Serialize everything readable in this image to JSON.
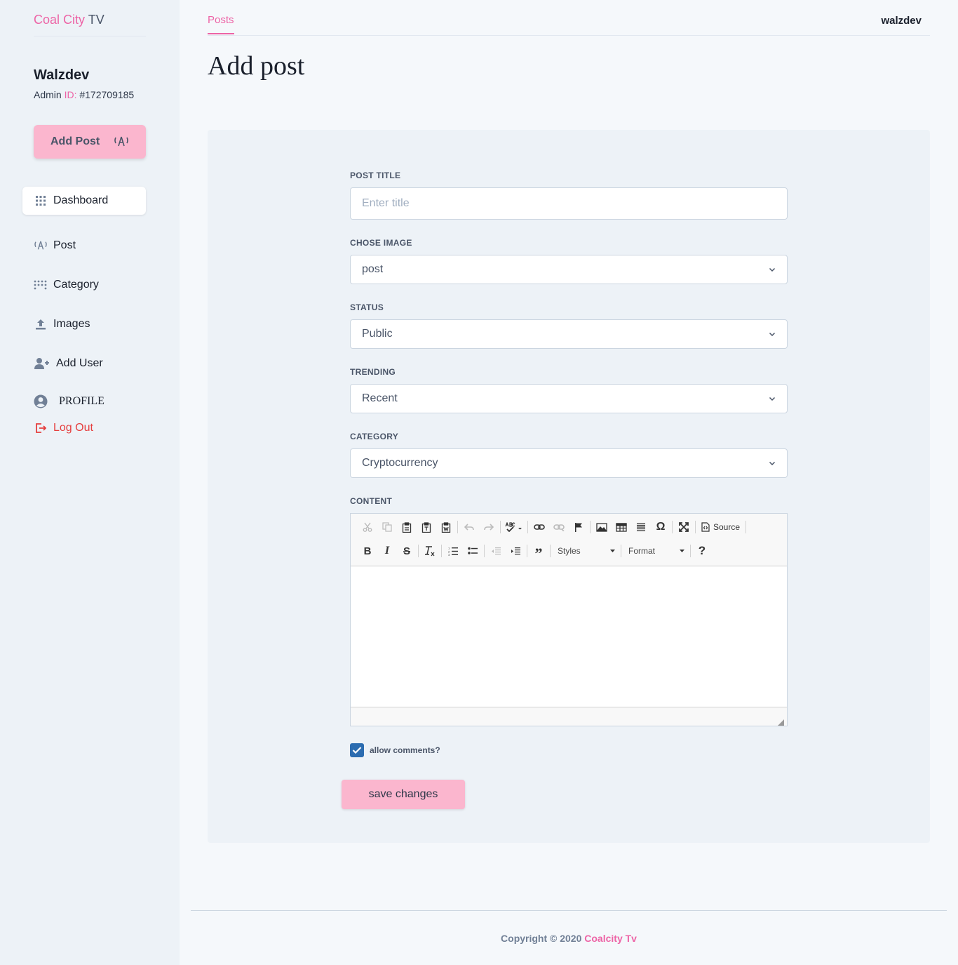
{
  "brand": {
    "part1": "Coal City",
    "part2": "TV"
  },
  "user": {
    "name": "Walzdev",
    "role": "Admin",
    "id_label": "ID:",
    "id_value": "#172709185"
  },
  "sidebar": {
    "add_post_label": "Add Post",
    "items": [
      {
        "label": "Dashboard",
        "icon": "grid-icon"
      },
      {
        "label": "Post",
        "icon": "broadcast-icon"
      },
      {
        "label": "Category",
        "icon": "dots-grid-icon"
      },
      {
        "label": "Images",
        "icon": "upload-icon"
      },
      {
        "label": "Add User",
        "icon": "user-add-icon"
      },
      {
        "label": "PROFILE",
        "icon": "user-circle-icon"
      },
      {
        "label": "Log Out",
        "icon": "logout-icon"
      }
    ]
  },
  "header": {
    "tab": "Posts",
    "username": "walzdev"
  },
  "page": {
    "title": "Add post"
  },
  "form": {
    "post_title_label": "POST TITLE",
    "post_title_placeholder": "Enter title",
    "image_label": "CHOSE IMAGE",
    "image_value": "post",
    "status_label": "STATUS",
    "status_value": "Public",
    "trending_label": "TRENDING",
    "trending_value": "Recent",
    "category_label": "CATEGORY",
    "category_value": "Cryptocurrency",
    "content_label": "CONTENT",
    "editor": {
      "source_label": "Source",
      "styles_label": "Styles",
      "format_label": "Format"
    },
    "allow_comments_label": "allow comments?",
    "allow_comments_checked": true,
    "save_label": "save changes"
  },
  "footer": {
    "text": "Copyright © 2020",
    "brand": "Coalcity Tv"
  },
  "colors": {
    "accent": "#ed64a6",
    "button": "#fbb6ce",
    "checkbox": "#2b6cb0",
    "logout": "#e53e3e"
  }
}
